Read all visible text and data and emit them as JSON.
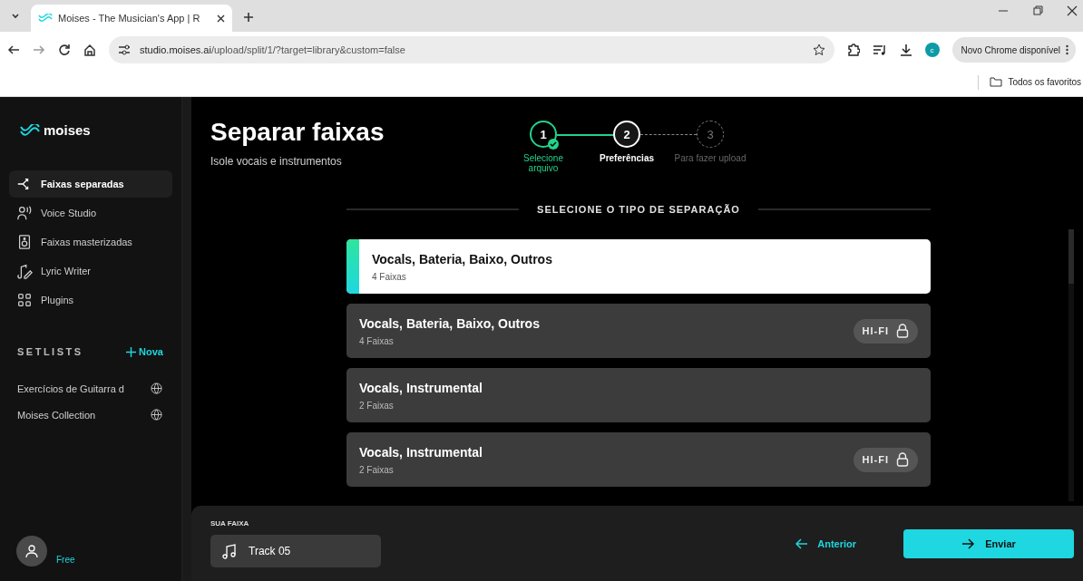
{
  "browser": {
    "tab_title": "Moises - The Musician's App | R",
    "url_host": "studio.moises.ai",
    "url_path": "/upload/split/1/?target=library&custom=false",
    "profile_initial": "c",
    "update_label": "Novo Chrome disponível",
    "bookmarks_folder": "Todos os favoritos"
  },
  "sidebar": {
    "logo": "moises",
    "items": [
      {
        "label": "Faixas separadas",
        "selected": true
      },
      {
        "label": "Voice Studio",
        "selected": false
      },
      {
        "label": "Faixas masterizadas",
        "selected": false
      },
      {
        "label": "Lyric Writer",
        "selected": false
      },
      {
        "label": "Plugins",
        "selected": false
      }
    ],
    "setlists_heading": "SETLISTS",
    "new_label": "Nova",
    "setlists": [
      {
        "name": "Exercícios de Guitarra d"
      },
      {
        "name": "Moises Collection"
      }
    ],
    "plan": "Free"
  },
  "page": {
    "title": "Separar faixas",
    "subtitle": "Isole vocais e instrumentos"
  },
  "steps": [
    {
      "number": "1",
      "label": "Selecione arquivo",
      "completed": true,
      "selected": false
    },
    {
      "number": "2",
      "label": "Preferências",
      "completed": false,
      "selected": true
    },
    {
      "number": "3",
      "label": "Para fazer upload",
      "completed": false,
      "selected": false
    }
  ],
  "section_heading": "SELECIONE O TIPO DE SEPARAÇÃO",
  "options": [
    {
      "title": "Vocals, Bateria, Baixo, Outros",
      "tracks": "4 Faixas",
      "selected": true
    },
    {
      "title": "Vocals, Bateria, Baixo, Outros",
      "tracks": "4 Faixas",
      "selected": false,
      "badge": "HI-FI",
      "locked": true
    },
    {
      "title": "Vocals, Instrumental",
      "tracks": "2 Faixas",
      "selected": false
    },
    {
      "title": "Vocals, Instrumental",
      "tracks": "2 Faixas",
      "selected": false,
      "badge": "HI-FI",
      "locked": true
    }
  ],
  "footer": {
    "track_heading": "SUA FAIXA",
    "track_name": "Track 05",
    "back_label": "Anterior",
    "next_label": "Enviar"
  }
}
